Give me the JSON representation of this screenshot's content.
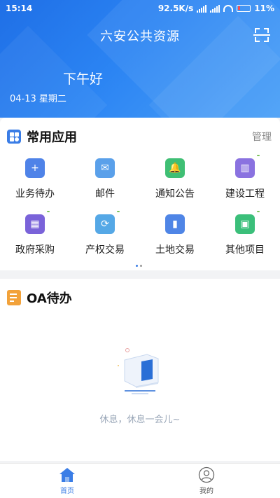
{
  "status_bar": {
    "time": "15:14",
    "network_speed": "92.5K/s",
    "battery": "11%"
  },
  "header": {
    "title": "六安公共资源",
    "greeting": "下午好",
    "date": "04-13 星期二"
  },
  "common_apps": {
    "title": "常用应用",
    "manage_label": "管理",
    "items": [
      {
        "label": "业务待办",
        "icon": "task-add-icon",
        "color": "#4f83e8"
      },
      {
        "label": "邮件",
        "icon": "mail-icon",
        "color": "#5aa0ea"
      },
      {
        "label": "通知公告",
        "icon": "bell-icon",
        "color": "#3fbf74"
      },
      {
        "label": "建设工程",
        "icon": "building-chart-icon",
        "color": "#8a72e0"
      },
      {
        "label": "政府采购",
        "icon": "grid-apps-icon",
        "color": "#7a63d9"
      },
      {
        "label": "产权交易",
        "icon": "property-exchange-icon",
        "color": "#55a8e6"
      },
      {
        "label": "土地交易",
        "icon": "land-buildings-icon",
        "color": "#4f85e6"
      },
      {
        "label": "其他项目",
        "icon": "briefcase-icon",
        "color": "#3bbf7a"
      }
    ]
  },
  "oa_todo": {
    "title": "OA待办",
    "empty_text": "休息，休息一会儿~"
  },
  "bottom_nav": {
    "home_label": "首页",
    "me_label": "我的"
  },
  "colors": {
    "primary": "#2b7de9",
    "accent_green": "#7cc35a"
  }
}
